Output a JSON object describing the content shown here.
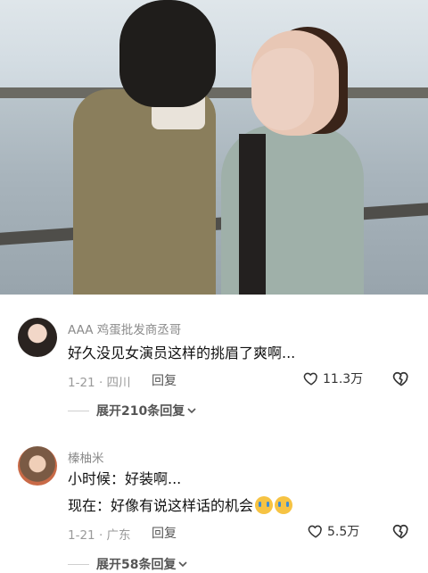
{
  "comments": [
    {
      "username": "AAA 鸡蛋批发商丞哥",
      "lines": [
        "好久没见女演员这样的挑眉了爽啊..."
      ],
      "date": "1-21",
      "location": "四川",
      "reply_label": "回复",
      "likes": "11.3万",
      "expand_label": "展开210条回复"
    },
    {
      "username": "榛柚米",
      "lines": [
        "小时候：好装啊...",
        "现在：好像有说这样话的机会"
      ],
      "date": "1-21",
      "location": "广东",
      "reply_label": "回复",
      "likes": "5.5万",
      "expand_label": "展开58条回复"
    }
  ],
  "icons": {
    "heart": "heart-outline-icon",
    "dislike": "broken-heart-icon",
    "emoji": "crying-laughing-emoji",
    "chevron": "chevron-down-icon"
  }
}
